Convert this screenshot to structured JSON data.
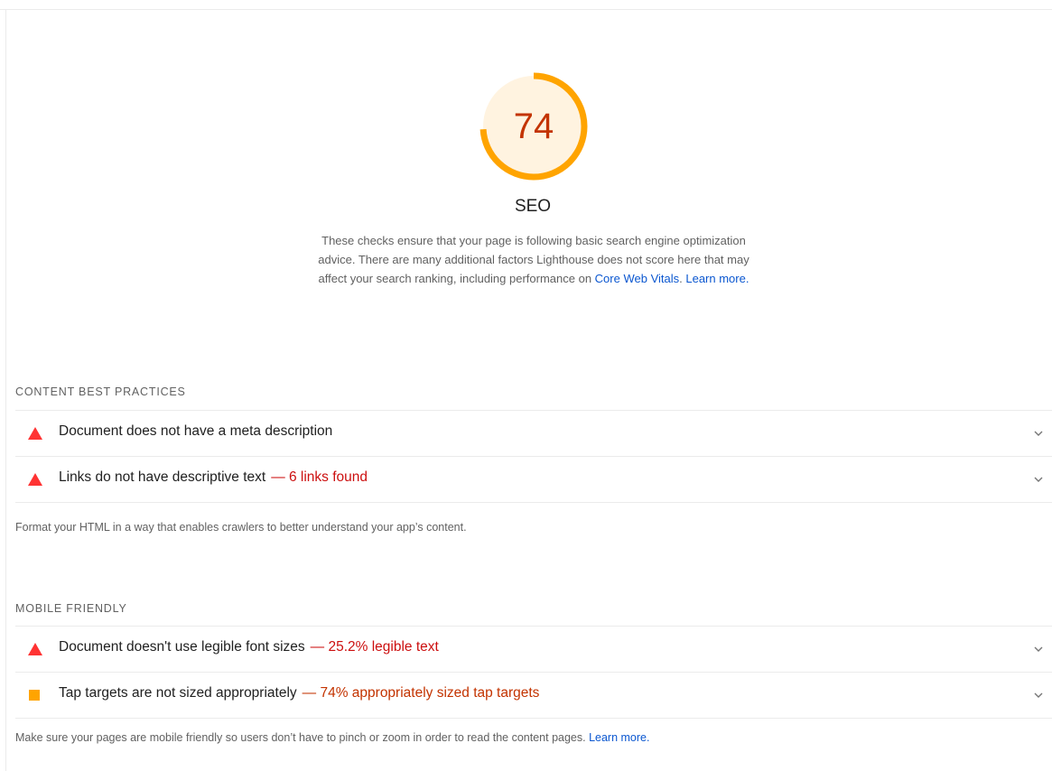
{
  "score": {
    "value": "74",
    "fraction": 0.74,
    "color": "#ffa400",
    "text_color": "#c33300",
    "fill": "#fff3e0"
  },
  "category": {
    "title": "SEO",
    "description": "These checks ensure that your page is following basic search engine optimization advice. There are many additional factors Lighthouse does not score here that may affect your search ranking, including performance on ",
    "link1": "Core Web Vitals",
    "sep": ". ",
    "link2": "Learn more",
    "end": "."
  },
  "groups": {
    "content": {
      "title": "CONTENT BEST PRACTICES",
      "description": "Format your HTML in a way that enables crawlers to better understand your app’s content.",
      "audits": [
        {
          "title": "Document does not have a meta description",
          "display": "",
          "status": "fail",
          "icon": "triangle-fail-icon"
        },
        {
          "title": "Links do not have descriptive text",
          "display": "— 6 links found",
          "status": "fail",
          "icon": "triangle-fail-icon"
        }
      ]
    },
    "mobile": {
      "title": "MOBILE FRIENDLY",
      "description": "Make sure your pages are mobile friendly so users don’t have to pinch or zoom in order to read the content pages. ",
      "link": "Learn more",
      "end": ".",
      "audits": [
        {
          "title": "Document doesn't use legible font sizes",
          "display": "— 25.2% legible text",
          "status": "fail",
          "icon": "triangle-fail-icon"
        },
        {
          "title": "Tap targets are not sized appropriately",
          "display": "— 74% appropriately sized tap targets",
          "status": "average",
          "icon": "square-average-icon"
        }
      ]
    }
  },
  "colors": {
    "fail": "#cc0f0f",
    "average": "#c33300",
    "average_icon": "#ffa400",
    "fail_icon": "#ff3333",
    "link": "#0b57d0"
  }
}
